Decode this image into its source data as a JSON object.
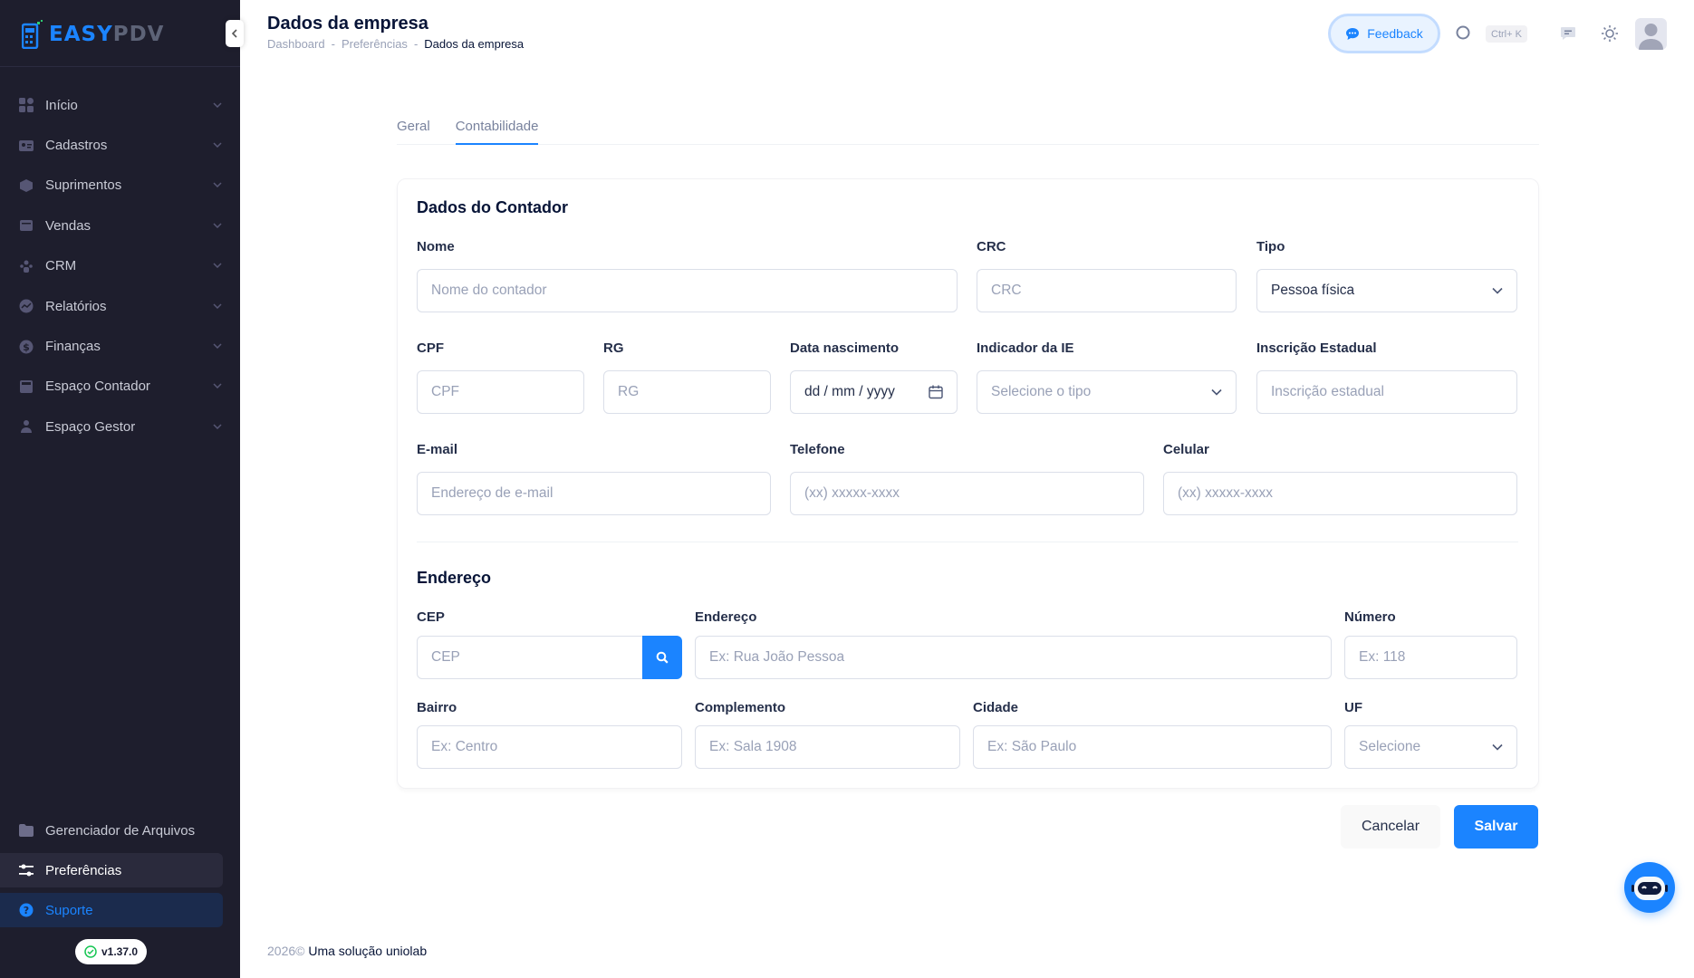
{
  "app": {
    "logo_easy": "EASY",
    "logo_pdv": "PDV",
    "version": "v1.37.0"
  },
  "sidebar": {
    "items": [
      {
        "label": "Início",
        "icon": "dashboard-icon"
      },
      {
        "label": "Cadastros",
        "icon": "address-card-icon"
      },
      {
        "label": "Suprimentos",
        "icon": "box-icon"
      },
      {
        "label": "Vendas",
        "icon": "cart-icon"
      },
      {
        "label": "CRM",
        "icon": "users-icon"
      },
      {
        "label": "Relatórios",
        "icon": "chart-icon"
      },
      {
        "label": "Finanças",
        "icon": "dollar-icon"
      },
      {
        "label": "Espaço Contador",
        "icon": "calculator-icon"
      },
      {
        "label": "Espaço Gestor",
        "icon": "user-tie-icon"
      }
    ],
    "bottom": {
      "files": "Gerenciador de Arquivos",
      "preferences": "Preferências",
      "support": "Suporte"
    }
  },
  "header": {
    "title": "Dados da empresa",
    "breadcrumb": [
      "Dashboard",
      "Preferências",
      "Dados da empresa"
    ],
    "breadcrumb_sep": "-",
    "feedback": "Feedback",
    "shortcut": "Ctrl+ K"
  },
  "tabs": [
    "Geral",
    "Contabilidade"
  ],
  "active_tab": "Contabilidade",
  "contador": {
    "title": "Dados do Contador",
    "nome": {
      "label": "Nome",
      "placeholder": "Nome do contador"
    },
    "crc": {
      "label": "CRC",
      "placeholder": "CRC"
    },
    "tipo": {
      "label": "Tipo",
      "value": "Pessoa física"
    },
    "cpf": {
      "label": "CPF",
      "placeholder": "CPF"
    },
    "rg": {
      "label": "RG",
      "placeholder": "RG"
    },
    "nascimento": {
      "label": "Data nascimento",
      "value": "dd / mm / yyyy"
    },
    "indicador_ie": {
      "label": "Indicador da IE",
      "placeholder": "Selecione o tipo"
    },
    "inscricao": {
      "label": "Inscrição Estadual",
      "placeholder": "Inscrição estadual"
    },
    "email": {
      "label": "E-mail",
      "placeholder": "Endereço de e-mail"
    },
    "telefone": {
      "label": "Telefone",
      "placeholder": "(xx) xxxxx-xxxx"
    },
    "celular": {
      "label": "Celular",
      "placeholder": "(xx) xxxxx-xxxx"
    }
  },
  "endereco": {
    "title": "Endereço",
    "cep": {
      "label": "CEP",
      "placeholder": "CEP"
    },
    "endereco": {
      "label": "Endereço",
      "placeholder": "Ex: Rua João Pessoa"
    },
    "numero": {
      "label": "Número",
      "placeholder": "Ex: 118"
    },
    "bairro": {
      "label": "Bairro",
      "placeholder": "Ex: Centro"
    },
    "complemento": {
      "label": "Complemento",
      "placeholder": "Ex: Sala 1908"
    },
    "cidade": {
      "label": "Cidade",
      "placeholder": "Ex: São Paulo"
    },
    "uf": {
      "label": "UF",
      "placeholder": "Selecione"
    }
  },
  "actions": {
    "cancel": "Cancelar",
    "save": "Salvar"
  },
  "footer": {
    "year": "2026©",
    "brand": "Uma solução uniolab"
  },
  "colors": {
    "accent": "#1b84ff",
    "sidebar_bg": "#1e1e2d"
  }
}
